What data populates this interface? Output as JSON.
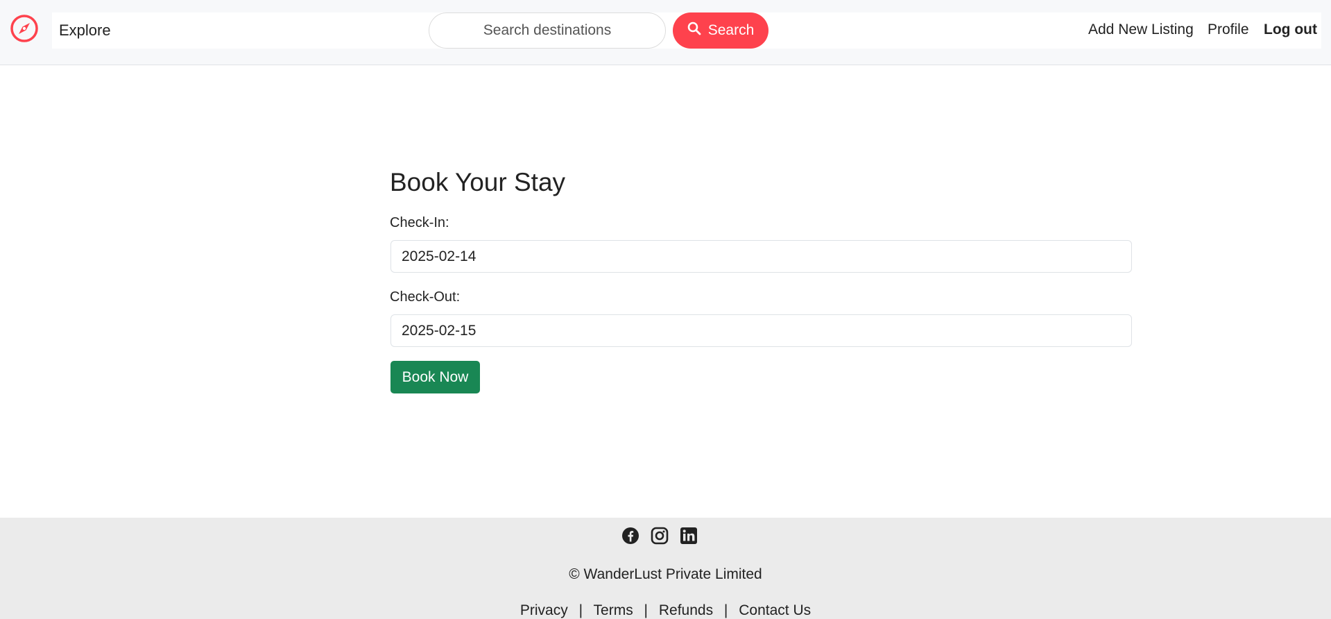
{
  "navbar": {
    "logo_icon": "compass-icon",
    "brand_color": "#fe424d",
    "explore_label": "Explore",
    "search": {
      "placeholder": "Search destinations",
      "button_label": "Search",
      "button_icon": "search-icon"
    },
    "links": {
      "add_listing": "Add New Listing",
      "profile": "Profile",
      "logout": "Log out"
    }
  },
  "booking": {
    "title": "Book Your Stay",
    "check_in_label": "Check-In:",
    "check_in_value": "2025-02-14",
    "check_out_label": "Check-Out:",
    "check_out_value": "2025-02-15",
    "submit_label": "Book Now",
    "submit_color": "#198754"
  },
  "footer": {
    "social_icons": [
      "facebook-icon",
      "instagram-icon",
      "linkedin-icon"
    ],
    "copyright": "© WanderLust Private Limited",
    "links": {
      "privacy": "Privacy",
      "terms": "Terms",
      "refunds": "Refunds",
      "contact": "Contact Us"
    },
    "separator": "|"
  }
}
